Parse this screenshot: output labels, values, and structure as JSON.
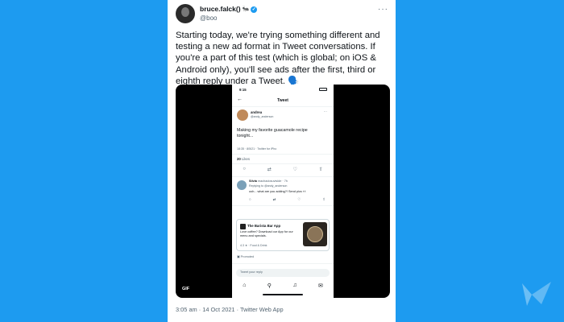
{
  "tweet": {
    "display_name": "bruce.falck()",
    "name_emoji": "🐜",
    "username": "@boo",
    "more_label": "···",
    "text": "Starting today, we're trying something different and testing a new ad format in Tweet conversations. If you're a part of this test (which is global; on iOS & Android only), you'll see ads after the first, third or eighth reply under a Tweet. 🗣️",
    "timestamp": "3:05 am · 14 Oct 2021 · Twitter Web App"
  },
  "media": {
    "badge": "GIF",
    "status_time": "9:15",
    "nav_title": "Tweet",
    "back_icon": "arrow-left-icon",
    "original": {
      "name": "andrea",
      "handle": "@andy_anderson",
      "text": "Making my favorite guacamole recipe tonight...",
      "meta": "18:35 · 8/5/21 · Twitter for iPho",
      "likes_count": "20",
      "likes_label": "Likes"
    },
    "reply": {
      "name": "Silvia",
      "handle": "machadosuviside · 7h",
      "replying": "Replying to @andy_anderson",
      "text": "ooh... what are you adding?! Send pics 👀"
    },
    "ad": {
      "name": "The Barista Bar App",
      "text": "Love coffee? Download our App for our menu and specials.",
      "rating": "4.3 ★ · Food & Drink",
      "promoted": "Promoted"
    },
    "reply_placeholder": "Tweet your reply"
  },
  "colors": {
    "background": "#1d9bf0",
    "accent": "#1d9bf0"
  }
}
